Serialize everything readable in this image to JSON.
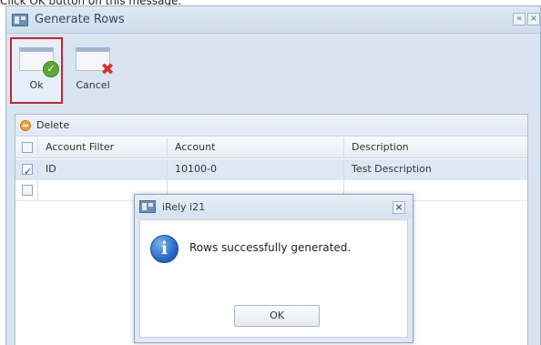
{
  "caption": "Click OK button on this message.",
  "window": {
    "title": "Generate Rows",
    "controls": {
      "collapse": "«",
      "close": "×"
    }
  },
  "toolbar": {
    "ok_label": "Ok",
    "cancel_label": "Cancel"
  },
  "grid": {
    "delete_label": "Delete",
    "columns": [
      "Account Filter",
      "Account",
      "Description"
    ],
    "rows": [
      {
        "checked": true,
        "account_filter": "ID",
        "account": "10100-0",
        "description": "Test Description"
      },
      {
        "checked": false,
        "account_filter": "",
        "account": "",
        "description": ""
      }
    ]
  },
  "dialog": {
    "title": "iRely i21",
    "close": "×",
    "message": "Rows successfully generated.",
    "ok_label": "OK",
    "icon": "info-icon"
  }
}
